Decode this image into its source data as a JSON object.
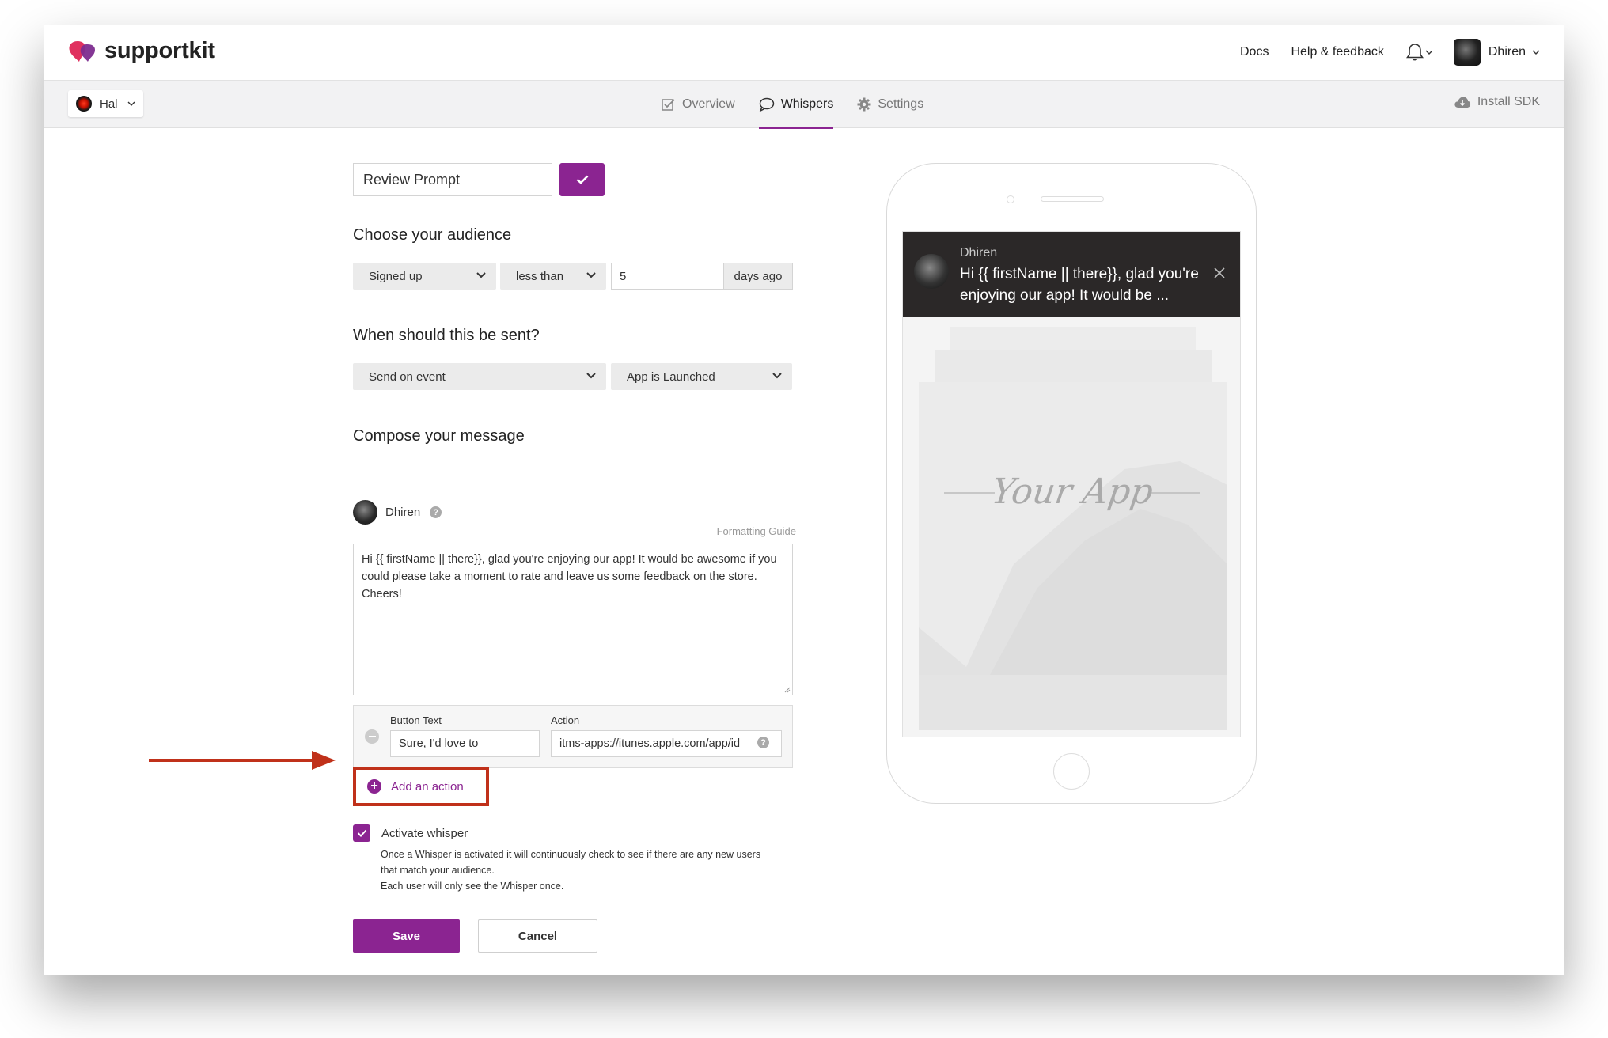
{
  "brand": {
    "name": "supportkit"
  },
  "header": {
    "links": [
      "Docs",
      "Help & feedback"
    ],
    "user_name": "Dhiren"
  },
  "subnav": {
    "app_name": "Hal",
    "tabs": [
      {
        "label": "Overview",
        "icon": "checkbox-icon"
      },
      {
        "label": "Whispers",
        "icon": "speech-bubble-icon",
        "active": true
      },
      {
        "label": "Settings",
        "icon": "gear-icon"
      }
    ],
    "install": "Install SDK"
  },
  "form": {
    "whisper_name": "Review Prompt",
    "audience_title": "Choose your audience",
    "audience_field": "Signed up",
    "audience_op": "less than",
    "audience_value": "5",
    "audience_unit": "days ago",
    "send_title": "When should this be sent?",
    "send_mode": "Send on event",
    "send_event": "App is Launched",
    "compose_title": "Compose your message",
    "author": "Dhiren",
    "formatting_guide": "Formatting Guide",
    "message": "Hi {{ firstName || there}}, glad you're enjoying our app! It would be awesome if you could please take a moment to rate and leave us some feedback on the store. Cheers!",
    "action": {
      "button_text_label": "Button Text",
      "button_text_value": "Sure, I'd love to",
      "action_label": "Action",
      "action_value": "itms-apps://itunes.apple.com/app/id"
    },
    "add_action": "Add an action",
    "activate_label": "Activate whisper",
    "activate_desc_1": "Once a Whisper is activated it will continuously check to see if there are any new users that match your audience.",
    "activate_desc_2": "Each user will only see the Whisper once.",
    "save": "Save",
    "cancel": "Cancel"
  },
  "preview": {
    "sender": "Dhiren",
    "text": "Hi {{ firstName || there}}, glad you're enjoying our app! It would be ...",
    "app_placeholder": "Your App"
  },
  "colors": {
    "accent": "#8b2491",
    "highlight": "#c0311a"
  }
}
